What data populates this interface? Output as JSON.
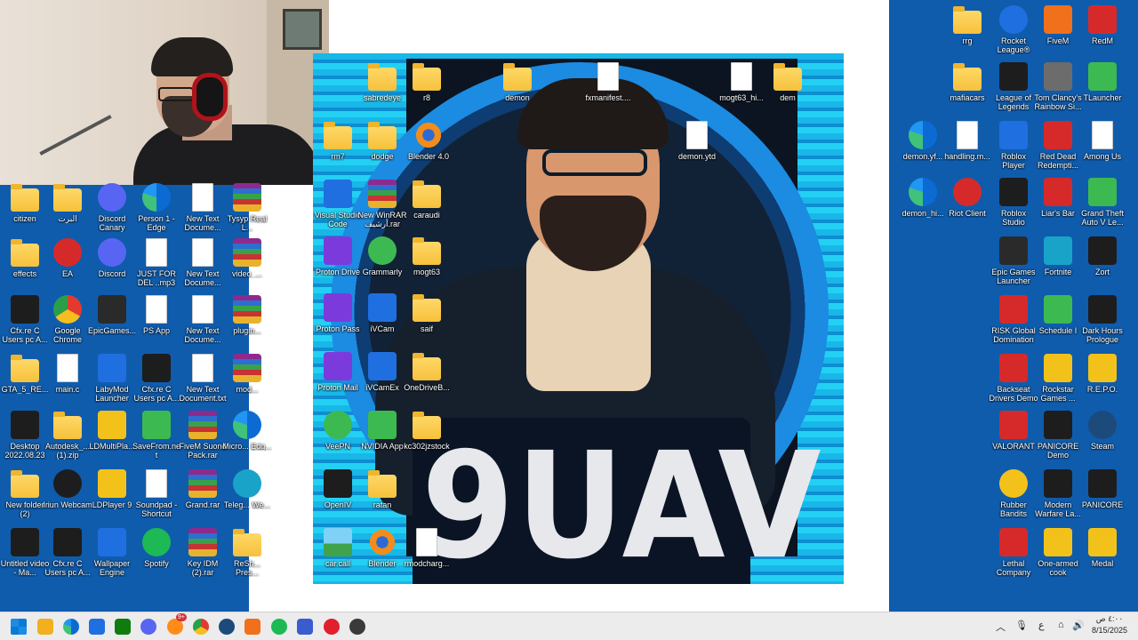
{
  "window": {
    "title": "Desktop"
  },
  "logo": {
    "text": "9UAV"
  },
  "desktop_icons": [
    {
      "id": "citizen",
      "label": "citizen",
      "icon": "folder-icon"
    },
    {
      "id": "albert",
      "label": "البرت",
      "icon": "folder-icon"
    },
    {
      "id": "discord-canary",
      "label": "Discord Canary",
      "icon": "discord-icon"
    },
    {
      "id": "person-edge",
      "label": "Person 1 - Edge",
      "icon": "edge-icon"
    },
    {
      "id": "new-text-1",
      "label": "New Text Docume...",
      "icon": "text-file-icon"
    },
    {
      "id": "tysyp",
      "label": "Tysyp Real L...",
      "icon": "rar-icon"
    },
    {
      "id": "effects",
      "label": "effects",
      "icon": "folder-icon"
    },
    {
      "id": "ea",
      "label": "EA",
      "icon": "ea-icon"
    },
    {
      "id": "discord",
      "label": "Discord",
      "icon": "discord-icon"
    },
    {
      "id": "just-for-del",
      "label": "JUST FOR DEL ..mp3",
      "icon": "audio-file-icon"
    },
    {
      "id": "new-text-2",
      "label": "New Text Docume...",
      "icon": "text-file-icon"
    },
    {
      "id": "video",
      "label": "video_...",
      "icon": "rar-icon"
    },
    {
      "id": "cfx-1",
      "label": "Cfx.re C Users pc A...",
      "icon": "cfx-icon"
    },
    {
      "id": "google-chrome",
      "label": "Google Chrome",
      "icon": "chrome-icon"
    },
    {
      "id": "epicgames",
      "label": "EpicGames...",
      "icon": "epic-icon"
    },
    {
      "id": "ps-app",
      "label": "PS App",
      "icon": "file-icon"
    },
    {
      "id": "new-text-3",
      "label": "New Text Docume...",
      "icon": "text-file-icon"
    },
    {
      "id": "plugins",
      "label": "plugin...",
      "icon": "rar-icon"
    },
    {
      "id": "gta5",
      "label": "GTA_5_RE...",
      "icon": "folder-icon"
    },
    {
      "id": "main-c",
      "label": "main.c",
      "icon": "c-file-icon"
    },
    {
      "id": "labymod",
      "label": "LabyMod Launcher",
      "icon": "labymod-icon"
    },
    {
      "id": "cfx-2",
      "label": "Cfx.re C Users pc A...",
      "icon": "cfx-icon"
    },
    {
      "id": "new-text-4",
      "label": "New Text Document.txt",
      "icon": "text-file-icon"
    },
    {
      "id": "mods",
      "label": "mod...",
      "icon": "rar-icon"
    },
    {
      "id": "desktop-2022",
      "label": "Desktop 2022.08.23 -...",
      "icon": "cfx-icon"
    },
    {
      "id": "autodesk",
      "label": "Autodesk_... (1).zip",
      "icon": "zip-icon"
    },
    {
      "id": "ldmultiplayer",
      "label": "LDMultiPla...",
      "icon": "ldplayer-icon"
    },
    {
      "id": "savefrom",
      "label": "SaveFrom.net",
      "icon": "download-icon"
    },
    {
      "id": "fivem-sound",
      "label": "FiveM Suond Pack.rar",
      "icon": "rar-icon"
    },
    {
      "id": "microsoft-edge",
      "label": "Micro... Edg...",
      "icon": "edge-icon"
    },
    {
      "id": "new-folder-2",
      "label": "New folder (2)",
      "icon": "folder-icon"
    },
    {
      "id": "iriun-webcam",
      "label": "Iriun Webcam",
      "icon": "webcam-icon"
    },
    {
      "id": "ldplayer9",
      "label": "LDPlayer 9",
      "icon": "ldplayer-icon"
    },
    {
      "id": "soundpad",
      "label": "Soundpad - Shortcut",
      "icon": "file-icon"
    },
    {
      "id": "grand-rar",
      "label": "Grand.rar",
      "icon": "rar-icon"
    },
    {
      "id": "telegram",
      "label": "Teleg... We...",
      "icon": "telegram-icon"
    },
    {
      "id": "untitled-video",
      "label": "Untitled video - Ma...",
      "icon": "video-icon"
    },
    {
      "id": "cfx-3",
      "label": "Cfx.re C Users pc A...",
      "icon": "cfx-icon"
    },
    {
      "id": "wallpaper-engine",
      "label": "Wallpaper Engine",
      "icon": "wallpaper-engine-icon"
    },
    {
      "id": "spotify",
      "label": "Spotify",
      "icon": "spotify-icon"
    },
    {
      "id": "key-idm",
      "label": "Key IDM (2).rar",
      "icon": "rar-icon"
    },
    {
      "id": "reshade",
      "label": "ReSh... Pres...",
      "icon": "folder-icon"
    },
    {
      "id": "vscode",
      "label": "Visual Studio Code",
      "icon": "vscode-icon"
    },
    {
      "id": "new-winrar",
      "label": "New WinRAR أرشيف.rar",
      "icon": "rar-icon"
    },
    {
      "id": "caraudi",
      "label": "caraudi",
      "icon": "folder-icon"
    },
    {
      "id": "proton-drive",
      "label": "Proton Drive",
      "icon": "proton-drive-icon"
    },
    {
      "id": "grammarly",
      "label": "Grammarly",
      "icon": "grammarly-icon"
    },
    {
      "id": "mogt63",
      "label": "mogt63",
      "icon": "folder-icon"
    },
    {
      "id": "proton-pass",
      "label": "Proton Pass",
      "icon": "proton-pass-icon"
    },
    {
      "id": "ivcam",
      "label": "iVCam",
      "icon": "ivcam-icon"
    },
    {
      "id": "saif",
      "label": "saif",
      "icon": "folder-icon"
    },
    {
      "id": "proton-mail",
      "label": "Proton Mail",
      "icon": "proton-mail-icon"
    },
    {
      "id": "ivcamex",
      "label": "iVCamEx",
      "icon": "ivcam-icon"
    },
    {
      "id": "onedrive-b",
      "label": "OneDriveB...",
      "icon": "folder-icon"
    },
    {
      "id": "veepn",
      "label": "VeePN",
      "icon": "veepn-icon"
    },
    {
      "id": "nvidia-app",
      "label": "NVIDIA App",
      "icon": "nvidia-icon"
    },
    {
      "id": "kc302",
      "label": "kc302jzstock",
      "icon": "folder-icon"
    },
    {
      "id": "openiv",
      "label": "OpenIV",
      "icon": "openiv-icon"
    },
    {
      "id": "ratan",
      "label": "ratan",
      "icon": "folder-icon"
    },
    {
      "id": "car-call",
      "label": "car.call",
      "icon": "image-folder-icon"
    },
    {
      "id": "blender-2",
      "label": "Blender",
      "icon": "blender-icon"
    },
    {
      "id": "rmodcharg",
      "label": "rmodcharg...",
      "icon": "file-icon"
    },
    {
      "id": "dodge",
      "label": "dodge",
      "icon": "folder-icon"
    },
    {
      "id": "blender-40",
      "label": "Blender 4.0",
      "icon": "blender-icon"
    },
    {
      "id": "demon-ytd",
      "label": "demon.ytd",
      "icon": "file-icon"
    },
    {
      "id": "rm7",
      "label": "rm7",
      "icon": "folder-icon"
    },
    {
      "id": "sabredeye",
      "label": "sabredeye",
      "icon": "folder-icon"
    },
    {
      "id": "r8",
      "label": "r8",
      "icon": "folder-icon"
    },
    {
      "id": "demon",
      "label": "demon",
      "icon": "folder-icon"
    },
    {
      "id": "fxmanifest",
      "label": "fxmanifest....",
      "icon": "text-file-icon"
    },
    {
      "id": "mogt63-hi",
      "label": "mogt63_hi...",
      "icon": "file-icon"
    },
    {
      "id": "dem",
      "label": "dem",
      "icon": "folder-icon"
    },
    {
      "id": "rrg",
      "label": "rrg",
      "icon": "folder-icon"
    },
    {
      "id": "rocket-league",
      "label": "Rocket League®",
      "icon": "rocket-league-icon"
    },
    {
      "id": "fivem",
      "label": "FiveM",
      "icon": "fivem-icon"
    },
    {
      "id": "redm",
      "label": "RedM",
      "icon": "redm-icon"
    },
    {
      "id": "mafiacars",
      "label": "mafiacars",
      "icon": "folder-icon"
    },
    {
      "id": "league",
      "label": "League of Legends",
      "icon": "lol-icon"
    },
    {
      "id": "rainbow-six",
      "label": "Tom Clancy's Rainbow Si...",
      "icon": "r6-icon"
    },
    {
      "id": "tlauncher",
      "label": "TLauncher",
      "icon": "tlauncher-icon"
    },
    {
      "id": "demon-yf",
      "label": "demon.yf...",
      "icon": "edge-icon"
    },
    {
      "id": "handling",
      "label": "handling.m...",
      "icon": "file-icon"
    },
    {
      "id": "roblox-player",
      "label": "Roblox Player",
      "icon": "roblox-icon"
    },
    {
      "id": "rdr2",
      "label": "Red Dead Redempti...",
      "icon": "rdr2-icon"
    },
    {
      "id": "among-us",
      "label": "Among Us",
      "icon": "file-icon"
    },
    {
      "id": "demon-hi",
      "label": "demon_hi...",
      "icon": "edge-icon"
    },
    {
      "id": "riot-client",
      "label": "Riot Client",
      "icon": "riot-icon"
    },
    {
      "id": "roblox-studio",
      "label": "Roblox Studio",
      "icon": "roblox-studio-icon"
    },
    {
      "id": "liars-bar",
      "label": "Liar's Bar",
      "icon": "liars-bar-icon"
    },
    {
      "id": "gta5-game",
      "label": "Grand Theft Auto V Le...",
      "icon": "gta-icon"
    },
    {
      "id": "epic-launcher",
      "label": "Epic Games Launcher",
      "icon": "epic-icon"
    },
    {
      "id": "fortnite",
      "label": "Fortnite",
      "icon": "fortnite-icon"
    },
    {
      "id": "zort",
      "label": "Zort",
      "icon": "zort-icon"
    },
    {
      "id": "risk",
      "label": "RISK Global Domination",
      "icon": "risk-icon"
    },
    {
      "id": "schedule",
      "label": "Schedule I",
      "icon": "schedule-icon"
    },
    {
      "id": "dark-hours",
      "label": "Dark Hours Prologue",
      "icon": "dark-hours-icon"
    },
    {
      "id": "backseat",
      "label": "Backseat Drivers Demo",
      "icon": "car-icon"
    },
    {
      "id": "rockstar",
      "label": "Rockstar Games ...",
      "icon": "rockstar-icon"
    },
    {
      "id": "repo",
      "label": "R.E.P.O.",
      "icon": "repo-icon"
    },
    {
      "id": "valorant",
      "label": "VALORANT",
      "icon": "valorant-icon"
    },
    {
      "id": "panicore-demo",
      "label": "PANICORE Demo",
      "icon": "panicore-icon"
    },
    {
      "id": "steam",
      "label": "Steam",
      "icon": "steam-icon"
    },
    {
      "id": "rubber-bandits",
      "label": "Rubber Bandits",
      "icon": "rubber-bandits-icon"
    },
    {
      "id": "mw",
      "label": "Modern Warfare La...",
      "icon": "mw-icon"
    },
    {
      "id": "panicore",
      "label": "PANICORE",
      "icon": "panicore-icon"
    },
    {
      "id": "lethal-company",
      "label": "Lethal Company",
      "icon": "lethal-company-icon"
    },
    {
      "id": "one-armed-cook",
      "label": "One-armed cook",
      "icon": "cook-icon"
    },
    {
      "id": "medal",
      "label": "Medal",
      "icon": "medal-icon"
    }
  ],
  "taskbar": {
    "apps": [
      {
        "id": "start",
        "icon": "windows-start-icon"
      },
      {
        "id": "file-explorer",
        "icon": "file-explorer-icon"
      },
      {
        "id": "edge",
        "icon": "edge-icon"
      },
      {
        "id": "store",
        "icon": "store-icon"
      },
      {
        "id": "xbox",
        "icon": "xbox-icon"
      },
      {
        "id": "discord",
        "icon": "discord-icon"
      },
      {
        "id": "messenger",
        "icon": "messenger-icon",
        "badge": "9+"
      },
      {
        "id": "chrome",
        "icon": "chrome-icon"
      },
      {
        "id": "steam",
        "icon": "steam-icon"
      },
      {
        "id": "fivem",
        "icon": "fivem-icon"
      },
      {
        "id": "spotify",
        "icon": "spotify-icon"
      },
      {
        "id": "app-blue",
        "icon": "app-icon"
      },
      {
        "id": "opera",
        "icon": "opera-icon"
      },
      {
        "id": "obs",
        "icon": "obs-icon"
      }
    ],
    "tray": {
      "lang": "ع",
      "time": "٤:٠٠ ص",
      "date": "8/15/2025"
    }
  },
  "colors": {
    "desktop": "#0f5cad",
    "panel": "#ffffff",
    "taskbar": "#ececec"
  }
}
